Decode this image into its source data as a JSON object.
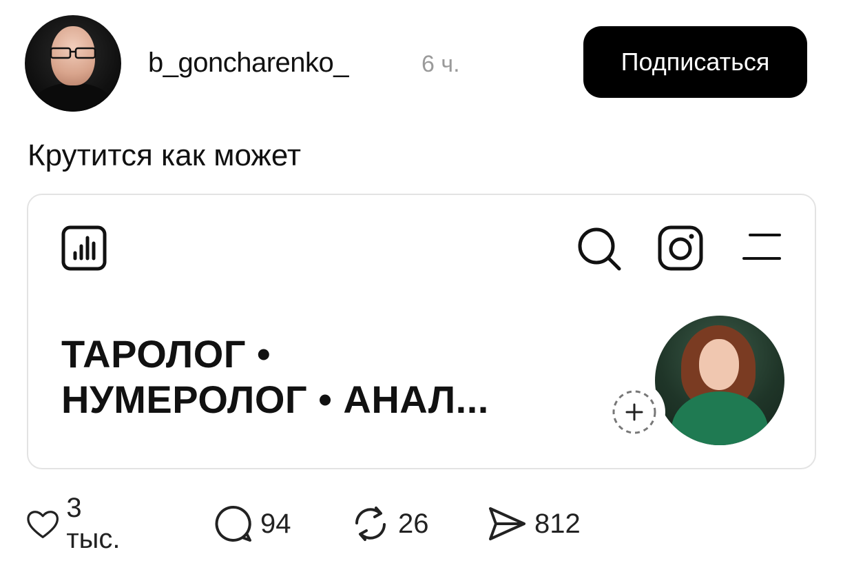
{
  "post": {
    "author": {
      "username": "b_goncharenko_",
      "time": "6 ч."
    },
    "follow_label": "Подписаться",
    "caption": "Крутится как может"
  },
  "embed": {
    "title_line1": "ТАРОЛОГ •",
    "title_line2": "НУМЕРОЛОГ • АНАЛ...",
    "icons": [
      "stats-icon",
      "search-icon",
      "instagram-icon",
      "menu-icon",
      "add-story-icon"
    ]
  },
  "actions": {
    "likes": "3 тыс.",
    "comments": "94",
    "reposts": "26",
    "shares": "812"
  },
  "colors": {
    "button_bg": "#000000",
    "button_text": "#ffffff",
    "muted_text": "#9a9a9a",
    "card_border": "#e3e3e3"
  }
}
